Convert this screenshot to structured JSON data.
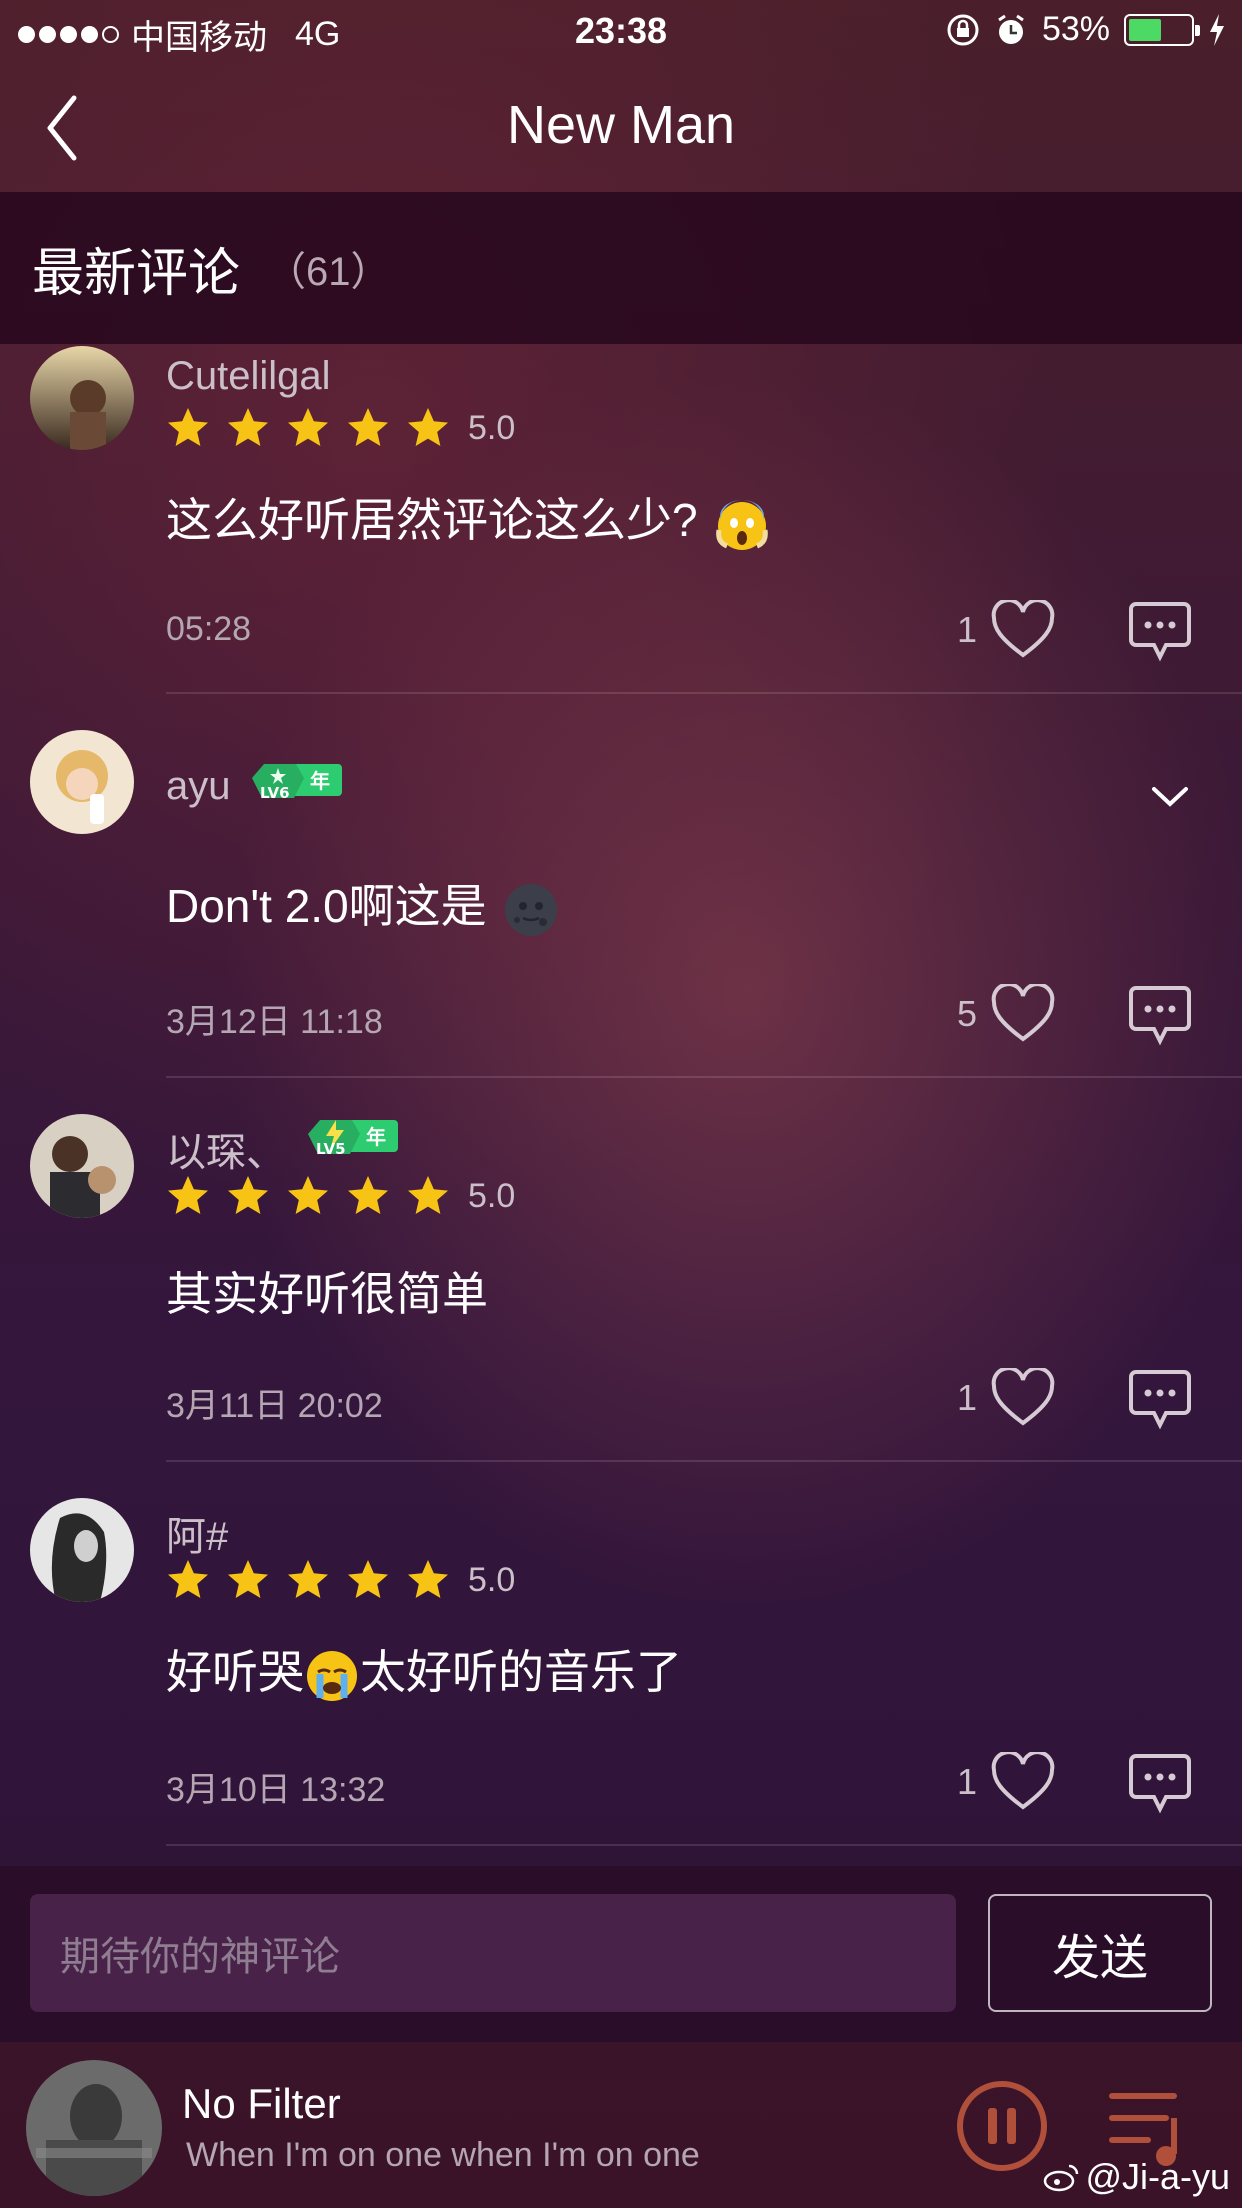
{
  "status_bar": {
    "carrier": "中国移动",
    "network": "4G",
    "time": "23:38",
    "battery_percent": "53%",
    "battery_level": 0.53
  },
  "nav": {
    "title": "New Man",
    "back_icon": "chevron-left-icon"
  },
  "section": {
    "title": "最新评论",
    "count": "（61）"
  },
  "comments": [
    {
      "username": "Cutelilgal",
      "stars": 5,
      "rating": "5.0",
      "text": "这么好听居然评论这么少?",
      "emoji": "scream-emoji",
      "time": "05:28",
      "likes": "1"
    },
    {
      "username": "ayu",
      "badge": "LV6",
      "badge_year": "年",
      "text": "Don't 2.0啊这是",
      "emoji": "new-moon-face-emoji",
      "time": "3月12日 11:18",
      "likes": "5"
    },
    {
      "username": "以琛、",
      "badge": "LV5",
      "badge_year": "年",
      "stars": 5,
      "rating": "5.0",
      "text": "其实好听很简单",
      "time": "3月11日 20:02",
      "likes": "1"
    },
    {
      "username": "阿#",
      "stars": 5,
      "rating": "5.0",
      "text_a": "好听哭",
      "emoji": "crying-emoji",
      "text_b": "太好听的音乐了",
      "time": "3月10日 13:32",
      "likes": "1"
    }
  ],
  "input": {
    "placeholder": "期待你的神评论",
    "send_label": "发送"
  },
  "player": {
    "title": "No Filter",
    "lyric": "When I'm on one when I'm on one"
  },
  "watermark": "@Ji-a-yu",
  "colors": {
    "star": "#f7c415",
    "badge_green": "#2ecc71",
    "battery_green": "#4cd964",
    "pause_ring": "#b0503a"
  }
}
